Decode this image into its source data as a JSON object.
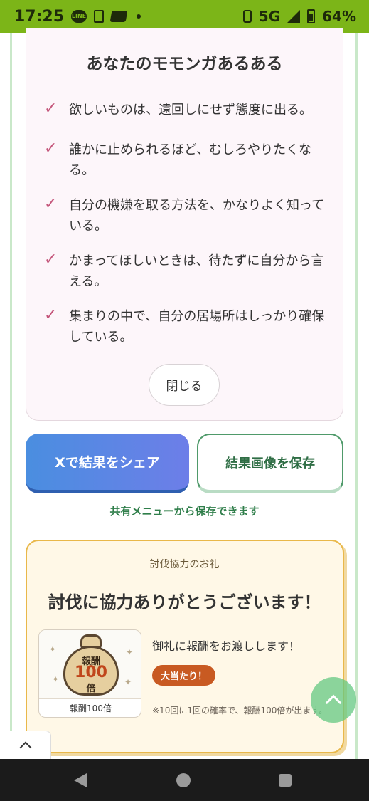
{
  "status_bar": {
    "time": "17:25",
    "network": "5G",
    "battery": "64%"
  },
  "aruaru": {
    "title": "あなたのモモンガあるある",
    "check_mark": "✓",
    "items": [
      "欲しいものは、遠回しにせず態度に出る。",
      "誰かに止められるほど、むしろやりたくなる。",
      "自分の機嫌を取る方法を、かなりよく知っている。",
      "かまってほしいときは、待たずに自分から言える。",
      "集まりの中で、自分の居場所はしっかり確保している。"
    ],
    "close_label": "閉じる"
  },
  "share": {
    "x_share_label": "Xで結果をシェア",
    "save_image_label": "結果画像を保存",
    "note": "共有メニューから保存できます"
  },
  "reward": {
    "small_heading": "討伐協力のお礼",
    "title": "討伐に協力ありがとうございます！",
    "bag_line1": "報酬",
    "bag_line2": "100",
    "bag_line3": "倍",
    "image_caption": "報酬100倍",
    "message": "御礼に報酬をお渡しします！",
    "badge": "大当たり！",
    "note": "※10回に1回の確率で、報酬100倍が出ます。"
  }
}
